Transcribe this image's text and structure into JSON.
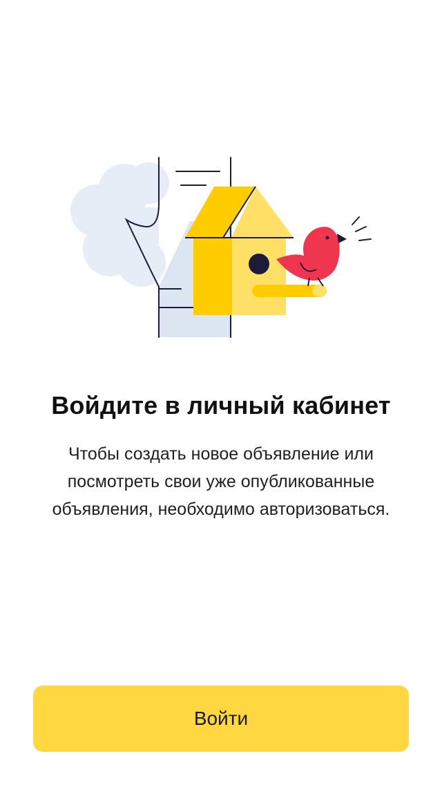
{
  "main": {
    "title": "Войдите в личный кабинет",
    "description": "Чтобы создать новое объявление или посмотреть свои уже опубликованные объявления, необходимо авторизоваться.",
    "illustration_icon": "birdhouse-with-bird-icon"
  },
  "login_button": {
    "label": "Войти"
  },
  "colors": {
    "accent": "#ffd740",
    "house_dark": "#ffcc00",
    "house_light": "#ffe066",
    "bird": "#f0364f",
    "cloud": "#e6edf7",
    "line": "#1c1b3a"
  }
}
